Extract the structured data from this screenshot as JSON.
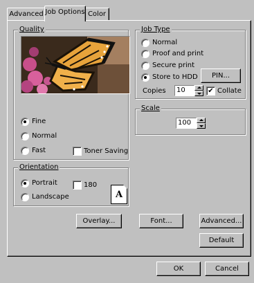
{
  "tabs": [
    {
      "label": "Advanced"
    },
    {
      "label": "Job Options"
    },
    {
      "label": "Color"
    }
  ],
  "quality": {
    "title": "Quality",
    "options": [
      {
        "label": "Fine",
        "selected": true
      },
      {
        "label": "Normal",
        "selected": false
      },
      {
        "label": "Fast",
        "selected": false
      }
    ],
    "toner_saving": {
      "label": "Toner Saving",
      "checked": false
    }
  },
  "job_type": {
    "title": "Job Type",
    "options": [
      {
        "label": "Normal",
        "selected": false
      },
      {
        "label": "Proof and print",
        "selected": false
      },
      {
        "label": "Secure print",
        "selected": false
      },
      {
        "label": "Store to HDD",
        "selected": true
      }
    ],
    "pin_button": "PIN...",
    "copies_label": "Copies",
    "copies_value": "10",
    "collate": {
      "label": "Collate",
      "checked": true,
      "mark": "✔"
    }
  },
  "scale": {
    "title": "Scale",
    "value": "100"
  },
  "orientation": {
    "title": "Orientation",
    "options": [
      {
        "label": "Portrait",
        "selected": true
      },
      {
        "label": "Landscape",
        "selected": false
      }
    ],
    "rotate180": {
      "label": "180",
      "checked": false
    },
    "page_letter": "A"
  },
  "buttons": {
    "overlay": "Overlay...",
    "font": "Font...",
    "advanced": "Advanced...",
    "default": "Default",
    "ok": "OK",
    "cancel": "Cancel"
  },
  "icons": {
    "portrait_page": "page-portrait-icon",
    "spinner_up": "spinner-up-icon",
    "spinner_down": "spinner-down-icon"
  },
  "colors": {
    "face": "#c0c0c0",
    "shadow": "#808080",
    "highlight": "#ffffff"
  }
}
